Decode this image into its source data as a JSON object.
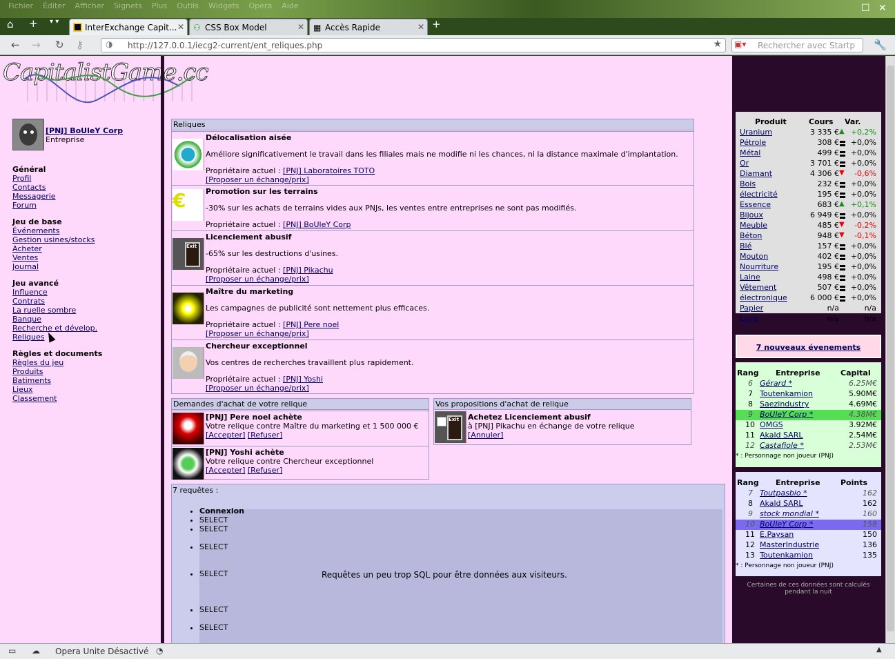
{
  "browser": {
    "menu": [
      "Fichier",
      "Éditer",
      "Afficher",
      "Signets",
      "Plus",
      "Outils",
      "Widgets",
      "Opera",
      "Aide"
    ],
    "tabs": [
      {
        "label": "InterExchange Capit...",
        "active": true
      },
      {
        "label": "CSS Box Model",
        "active": false
      },
      {
        "label": "Accès Rapide",
        "active": false
      }
    ],
    "url": "http://127.0.0.1/iecg2-current/ent_reliques.php",
    "search_placeholder": "Rechercher avec Startp",
    "status": "Opera Unite Désactivé"
  },
  "site": {
    "logo": "CapitalistGame.cc"
  },
  "user": {
    "name": "[PNJ] BoUleY Corp",
    "type": "Entreprise"
  },
  "sidebar": [
    {
      "title": "Général",
      "links": [
        "Profil",
        "Contacts",
        "Messagerie",
        "Forum"
      ]
    },
    {
      "title": "Jeu de base",
      "links": [
        "Événements",
        "Gestion usines/stocks",
        "Acheter",
        "Ventes",
        "Journal"
      ]
    },
    {
      "title": "Jeu avancé",
      "links": [
        "Influence",
        "Contrats",
        "La ruelle sombre",
        "Banque",
        "Recherche et dévelop.",
        "Reliques"
      ]
    },
    {
      "title": "Règles et documents",
      "links": [
        "Règles du jeu",
        "Produits",
        "Batiments",
        "Lieux",
        "Classement"
      ]
    }
  ],
  "reliques": {
    "header": "Reliques",
    "owner_label": "Propriétaire actuel :",
    "propose": "[Proposer un échange/prix]",
    "items": [
      {
        "title": "Délocalisation aisée",
        "desc": "Améliore significativement le travail dans les filiales mais ne modifie ni les chances, ni la distance maximale d'implantation.",
        "owner": "[PNJ] Laboratoires TOTO",
        "propose": true
      },
      {
        "title": "Promotion sur les terrains",
        "desc": "-30% sur les achats de terrains vides aux PNJs, les ventes entre entreprises ne sont pas modifiés.",
        "owner": "[PNJ] BoUleY Corp",
        "propose": false
      },
      {
        "title": "Licenciement abusif",
        "desc": "-65% sur les destructions d'usines.",
        "owner": "[PNJ] Pikachu",
        "propose": true
      },
      {
        "title": "Maître du marketing",
        "desc": "Les campagnes de publicité sont nettement plus efficaces.",
        "owner": "[PNJ] Pere noel",
        "propose": true
      },
      {
        "title": "Chercheur exceptionnel",
        "desc": "Vos centres de recherches travaillent plus rapidement.",
        "owner": "[PNJ] Yoshi",
        "propose": true
      }
    ]
  },
  "demandes": {
    "header": "Demandes d'achat de votre relique",
    "accept": "[Accepter]",
    "refuse": "[Refuser]",
    "items": [
      {
        "title": "[PNJ] Pere noel achète",
        "desc": "Votre relique contre Maître du marketing et 1 500 000 €"
      },
      {
        "title": "[PNJ] Yoshi achète",
        "desc": "Votre relique contre Chercheur exceptionnel"
      }
    ]
  },
  "propositions": {
    "header": "Vos propositions d'achat de relique",
    "title": "Achetez Licenciement abusif",
    "desc": "à [PNJ] Pikachu en échange de votre relique",
    "cancel": "[Annuler]"
  },
  "sql": {
    "count": "7 requêtes :",
    "items": [
      "Connexion",
      "SELECT",
      "SELECT",
      "SELECT",
      "SELECT",
      "SELECT",
      "SELECT"
    ],
    "overlay": "Requêtes un peu trop SQL pour être données aux visiteurs."
  },
  "market": {
    "headers": [
      "Produit",
      "Cours",
      "Var."
    ],
    "rows": [
      [
        "Uranium",
        "3 335 €",
        "up",
        "+0,2%"
      ],
      [
        "Pétrole",
        "308 €",
        "eq",
        "+0,0%"
      ],
      [
        "Métal",
        "499 €",
        "eq",
        "+0,0%"
      ],
      [
        "Or",
        "3 701 €",
        "eq",
        "+0,0%"
      ],
      [
        "Diamant",
        "4 306 €",
        "dn",
        "-0,6%"
      ],
      [
        "Bois",
        "232 €",
        "eq",
        "+0,0%"
      ],
      [
        "électricité",
        "195 €",
        "eq",
        "+0,0%"
      ],
      [
        "Essence",
        "683 €",
        "up",
        "+0,1%"
      ],
      [
        "Bijoux",
        "6 949 €",
        "eq",
        "+0,0%"
      ],
      [
        "Meuble",
        "485 €",
        "dn",
        "-0,2%"
      ],
      [
        "Béton",
        "948 €",
        "dn",
        "-0,1%"
      ],
      [
        "Blé",
        "157 €",
        "eq",
        "+0,0%"
      ],
      [
        "Mouton",
        "402 €",
        "eq",
        "+0,0%"
      ],
      [
        "Nourriture",
        "195 €",
        "eq",
        "+0,0%"
      ],
      [
        "Laine",
        "498 €",
        "eq",
        "+0,0%"
      ],
      [
        "Vêtement",
        "507 €",
        "eq",
        "+0,0%"
      ],
      [
        "électronique",
        "6 000 €",
        "eq",
        "+0,0%"
      ],
      [
        "Papier",
        "n/a",
        "",
        "n/a"
      ],
      [
        "Livre",
        "n/a",
        "",
        "n/a"
      ]
    ]
  },
  "events": "7 nouveaux évenements",
  "capital": {
    "headers": [
      "Rang",
      "Entreprise",
      "Capital"
    ],
    "rows": [
      [
        "6",
        "Gérard *",
        "6.25M€",
        true,
        false
      ],
      [
        "7",
        "Toutenkamion",
        "5.90M€",
        false,
        false
      ],
      [
        "8",
        "Saezindustry",
        "4.69M€",
        false,
        false
      ],
      [
        "9",
        "BoUleY Corp *",
        "4.38M€",
        true,
        true
      ],
      [
        "10",
        "OMGS",
        "3.92M€",
        false,
        false
      ],
      [
        "11",
        "Akald SARL",
        "2.54M€",
        false,
        false
      ],
      [
        "12",
        "Castafiole *",
        "2.53M€",
        true,
        false
      ]
    ],
    "note": "* : Personnage non joueur (PNJ)"
  },
  "points": {
    "headers": [
      "Rang",
      "Entreprise",
      "Points"
    ],
    "rows": [
      [
        "7",
        "Toutpasbio *",
        "162",
        true,
        false
      ],
      [
        "8",
        "Akald SARL",
        "162",
        false,
        false
      ],
      [
        "9",
        "stock mondial *",
        "160",
        true,
        false
      ],
      [
        "10",
        "BoUleY Corp *",
        "158",
        true,
        true
      ],
      [
        "11",
        "E.Paysan",
        "150",
        false,
        false
      ],
      [
        "12",
        "MasterIndustrie",
        "136",
        false,
        false
      ],
      [
        "13",
        "Toutenkamion",
        "135",
        false,
        false
      ]
    ],
    "note": "* : Personnage non joueur (PNJ)"
  },
  "footer_note": "Certaines de ces données sont calculés pendant la nuit"
}
